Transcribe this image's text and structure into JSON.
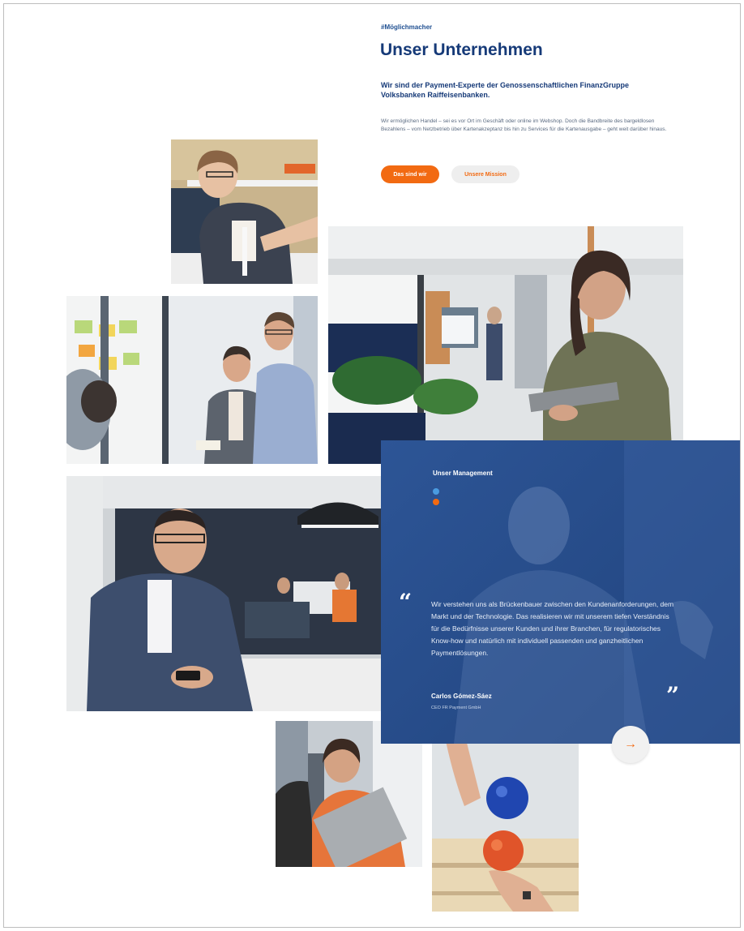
{
  "header": {
    "eyebrow": "#Möglichmacher",
    "title": "Unser Unternehmen",
    "subtitle": "Wir sind der Payment-Experte der Genossenschaftlichen FinanzGruppe Volksbanken Raiffeisenbanken.",
    "body": "Wir ermöglichen Handel – sei es vor Ort im Geschäft oder online im Webshop. Doch die Bandbreite des bargeldlosen Bezahlens – vom Netzbetrieb über Kartenakzeptanz bis hin zu Services für die Kartenausgabe – geht weit darüber hinaus."
  },
  "buttons": {
    "primary": "Das sind wir",
    "secondary": "Unsere Mission"
  },
  "management": {
    "label": "Unser Management",
    "quote_open": "“",
    "quote_close": "”",
    "quote": "Wir verstehen uns als Brückenbauer zwischen den Kundenanforderungen, dem Markt und der Technologie. Das realisieren wir mit unserem tiefen Verständnis für die Bedürfnisse unserer Kunden und ihrer Branchen, für regulatorisches Know-how und natürlich mit individuell passenden und ganzheitlichen Paymentlösungen.",
    "author": "Carlos Gómez-Sáez",
    "role": "CEO FR Payment GmbH",
    "next_icon": "→"
  },
  "icons": {
    "next": "arrow-right-icon",
    "quote_open": "quote-open-icon",
    "quote_close": "quote-close-icon"
  },
  "colors": {
    "brand_blue": "#163a78",
    "accent_orange": "#f26a12",
    "panel_blue": "#2d5596"
  }
}
